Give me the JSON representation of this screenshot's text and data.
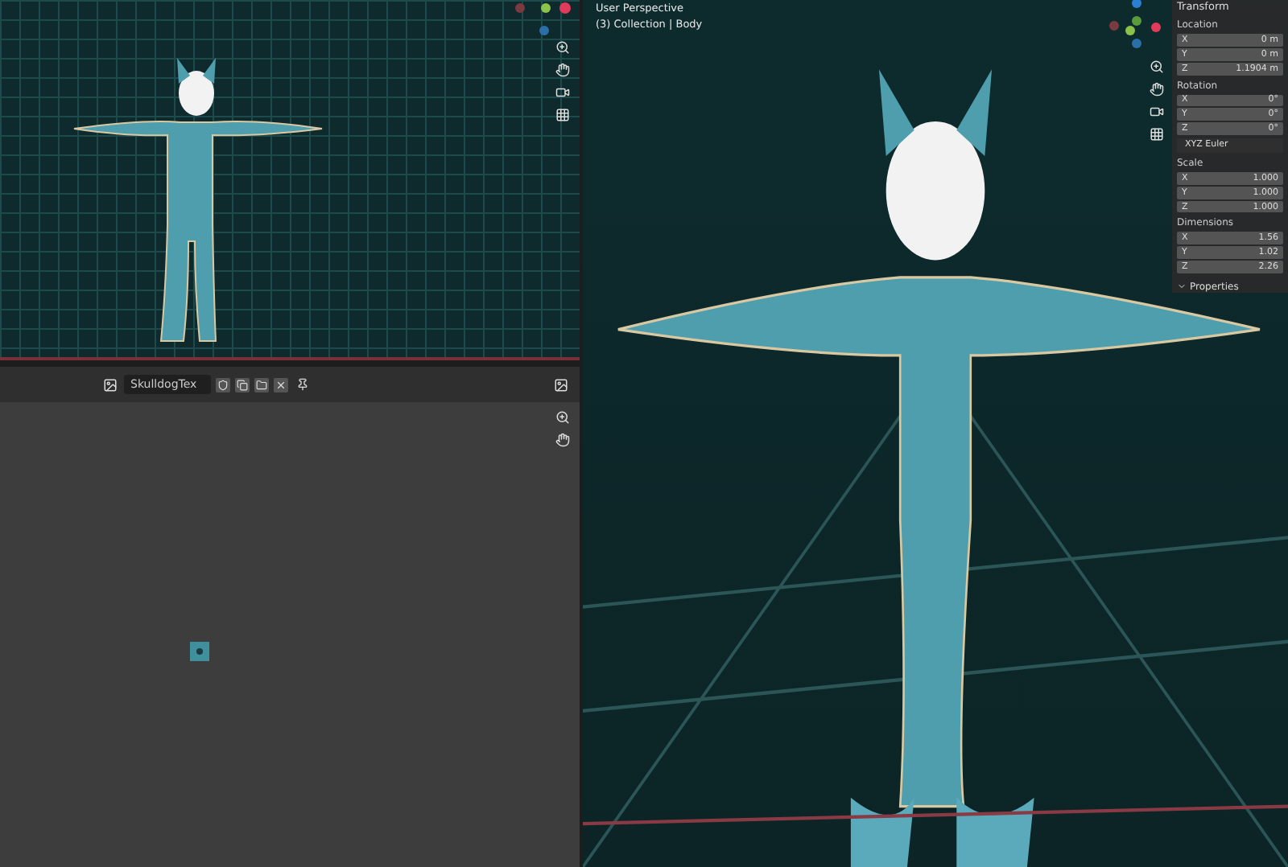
{
  "image_editor": {
    "image_name": "SkulldogTex"
  },
  "viewport": {
    "view_name": "User Perspective",
    "collection": "(3) Collection | Body"
  },
  "sidebar": {
    "panel_title": "Transform",
    "items": [
      {
        "kind": "vector",
        "label": "Location",
        "fields": [
          {
            "axis": "X",
            "value": "0 m"
          },
          {
            "axis": "Y",
            "value": "0 m"
          },
          {
            "axis": "Z",
            "value": "1.1904 m"
          }
        ]
      },
      {
        "kind": "vector",
        "label": "Rotation",
        "fields": [
          {
            "axis": "X",
            "value": "0°"
          },
          {
            "axis": "Y",
            "value": "0°"
          },
          {
            "axis": "Z",
            "value": "0°"
          }
        ]
      },
      {
        "kind": "dropdown",
        "value": "XYZ Euler"
      },
      {
        "kind": "vector",
        "label": "Scale",
        "fields": [
          {
            "axis": "X",
            "value": "1.000"
          },
          {
            "axis": "Y",
            "value": "1.000"
          },
          {
            "axis": "Z",
            "value": "1.000"
          }
        ]
      },
      {
        "kind": "vector",
        "label": "Dimensions",
        "fields": [
          {
            "axis": "X",
            "value": "1.56"
          },
          {
            "axis": "Y",
            "value": "1.02"
          },
          {
            "axis": "Z",
            "value": "2.26"
          }
        ]
      }
    ],
    "sub_panel": "Properties"
  }
}
